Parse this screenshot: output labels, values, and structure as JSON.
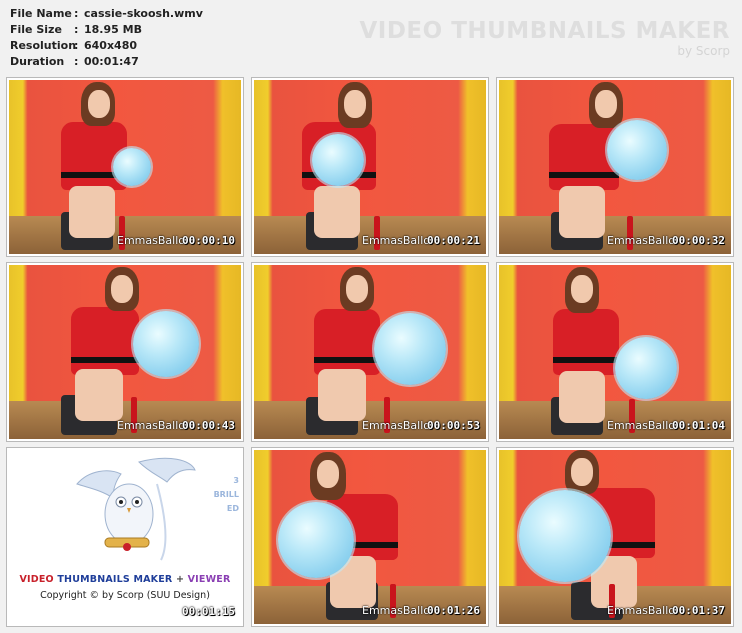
{
  "info": {
    "rows": [
      {
        "key": "File Name",
        "value": "cassie-skoosh.wmv"
      },
      {
        "key": "File Size",
        "value": "18.95 MB"
      },
      {
        "key": "Resolution",
        "value": "640x480"
      },
      {
        "key": "Duration",
        "value": "00:01:47"
      }
    ]
  },
  "brand": {
    "title": "VIDEO THUMBNAILS MAKER",
    "subtitle": "by Scorp"
  },
  "thumbnails": [
    {
      "watermark": "EmmasBallo",
      "timestamp": "00:00:10"
    },
    {
      "watermark": "EmmasBallo",
      "timestamp": "00:00:21"
    },
    {
      "watermark": "EmmasBallo",
      "timestamp": "00:00:32"
    },
    {
      "watermark": "EmmasBallo",
      "timestamp": "00:00:43"
    },
    {
      "watermark": "EmmasBallo",
      "timestamp": "00:00:53"
    },
    {
      "watermark": "EmmasBallo",
      "timestamp": "00:01:04"
    },
    {
      "watermark": "EmmasBallo",
      "timestamp": "00:01:26"
    },
    {
      "watermark": "EmmasBallo",
      "timestamp": "00:01:37"
    }
  ],
  "promo": {
    "title_part1": "VIDEO",
    "title_part2": "THUMBNAILS MAKER",
    "title_plus": "+",
    "title_part3": "VIEWER",
    "copyright": "Copyright © by Scorp (SUU Design)",
    "timestamp": "00:01:15",
    "side_3": "3",
    "side_brill": "BRILL",
    "side_ed": "ED",
    "colors": {
      "video": "#c8202a",
      "thumbs": "#1f3e9a",
      "viewer": "#8a3fb3"
    }
  }
}
